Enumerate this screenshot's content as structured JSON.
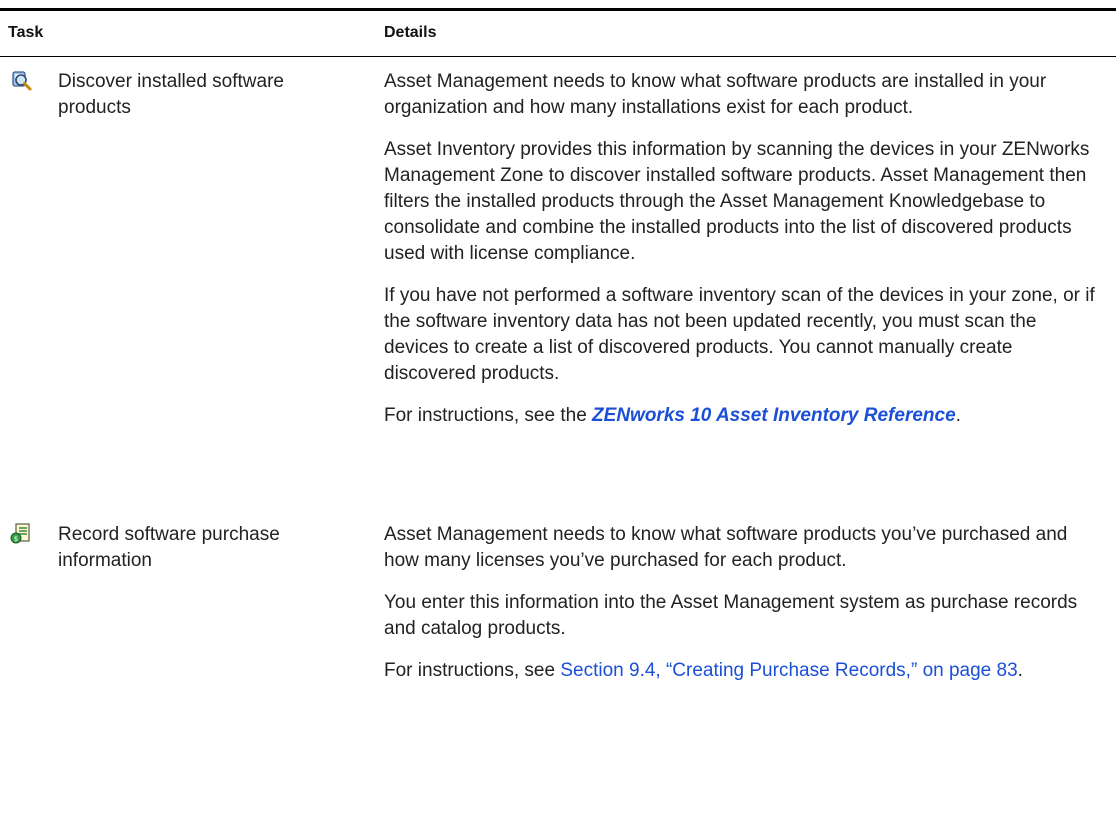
{
  "header": {
    "task": "Task",
    "details": "Details"
  },
  "rows": [
    {
      "task": "Discover installed software products",
      "icon": "discover-magnifier-icon",
      "paragraphs": [
        "Asset Management needs to know what software products are installed in your organization and how many installations exist for each product.",
        "Asset Inventory provides this information by scanning the devices in your ZENworks Management Zone to discover installed software products. Asset Management then filters the installed products through the Asset Management Knowledgebase to consolidate and combine the installed products into the list of discovered products used with license compliance.",
        "If you have not performed a software inventory scan of the devices in your zone, or if the software inventory data has not been updated recently, you must scan the devices to create a list of discovered products. You cannot manually create discovered products."
      ],
      "instr_prefix": "For instructions, see the ",
      "instr_link": "ZENworks 10 Asset Inventory Reference",
      "instr_suffix": "."
    },
    {
      "task": "Record software purchase information",
      "icon": "purchase-record-icon",
      "paragraphs": [
        "Asset Management needs to know what software products you’ve purchased and how many licenses you’ve purchased for each product.",
        "You enter this information into the Asset Management system as purchase records and catalog products."
      ],
      "instr_prefix": "For instructions, see ",
      "instr_link": "Section 9.4, “Creating Purchase Records,” on page 83",
      "instr_suffix": "."
    }
  ],
  "colors": {
    "link": "#1a4fd6",
    "rule": "#000000"
  }
}
